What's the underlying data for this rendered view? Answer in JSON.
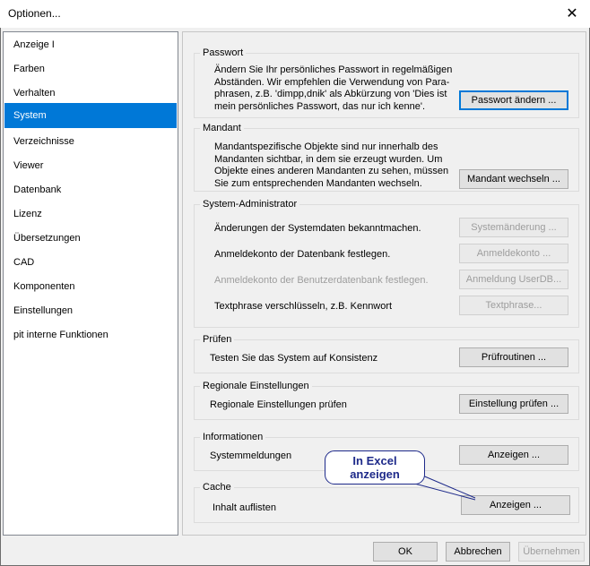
{
  "window": {
    "title": "Optionen...",
    "close_icon": "close-icon"
  },
  "sidebar": {
    "selected_index": 3,
    "items": [
      "Anzeige I",
      "Farben",
      "Verhalten",
      "System",
      "Verzeichnisse",
      "Viewer",
      "Datenbank",
      "Lizenz",
      "Übersetzungen",
      "CAD",
      "Komponenten",
      "Einstellungen",
      "pit interne Funktionen"
    ]
  },
  "passwort": {
    "title": "Passwort",
    "lines": [
      "Ändern Sie Ihr persönliches Passwort in regelmäßigen",
      "Abständen. Wir empfehlen die Verwendung von Para-",
      "phrasen, z.B. 'dimpp,dnik' als Abkürzung von 'Dies ist",
      "mein persönliches Passwort, das nur ich kenne'."
    ],
    "button": "Passwort ändern ..."
  },
  "mandant": {
    "title": "Mandant",
    "lines": [
      "Mandantspezifische Objekte sind nur innerhalb des",
      "Mandanten sichtbar, in dem sie erzeugt wurden. Um",
      "Objekte eines anderen Mandanten zu sehen, müssen",
      "Sie zum entsprechenden Mandanten wechseln."
    ],
    "button": "Mandant wechseln ..."
  },
  "sysadmin": {
    "title": "System-Administrator",
    "rows": [
      {
        "label": "Änderungen der Systemdaten bekanntmachen.",
        "button": "Systemänderung ..."
      },
      {
        "label": "Anmeldekonto der Datenbank festlegen.",
        "button": "Anmeldekonto ..."
      },
      {
        "label": "Anmeldekonto der Benutzerdatenbank festlegen.",
        "button": "Anmeldung UserDB..."
      },
      {
        "label": "Textphrase verschlüsseln, z.B. Kennwort",
        "button": "Textphrase..."
      }
    ]
  },
  "pruefen": {
    "title": "Prüfen",
    "label": "Testen Sie das System auf Konsistenz",
    "button": "Prüfroutinen ..."
  },
  "regional": {
    "title": "Regionale Einstellungen",
    "label": "Regionale Einstellungen prüfen",
    "button": "Einstellung prüfen ..."
  },
  "informationen": {
    "title": "Informationen",
    "label": "Systemmeldungen",
    "button": "Anzeigen ..."
  },
  "cache": {
    "title": "Cache",
    "label": "Inhalt auflisten",
    "button": "Anzeigen ..."
  },
  "callout": {
    "line1": "In Excel",
    "line2": "anzeigen"
  },
  "footer": {
    "ok": "OK",
    "cancel": "Abbrechen",
    "apply": "Übernehmen"
  },
  "colors": {
    "selection": "#0078d7",
    "callout": "#1e2a8a"
  }
}
